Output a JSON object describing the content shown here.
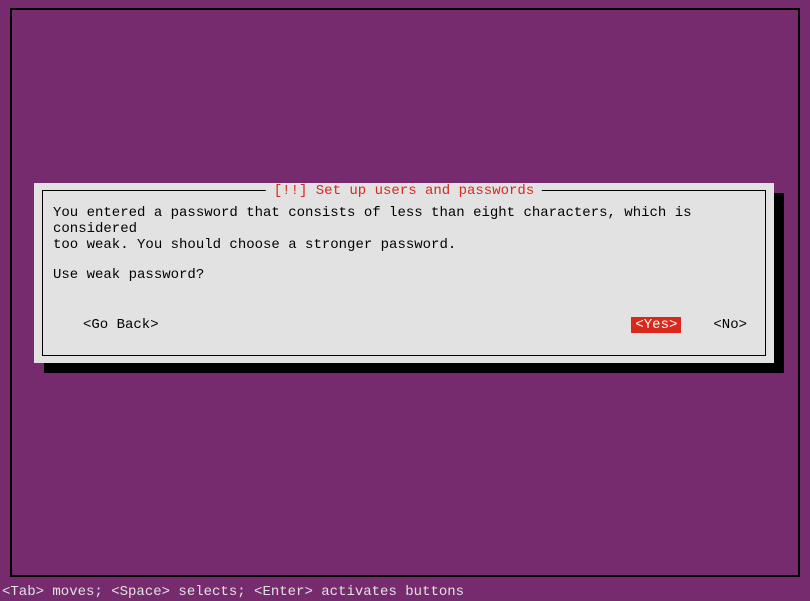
{
  "dialog": {
    "title": "[!!] Set up users and passwords",
    "message": "You entered a password that consists of less than eight characters, which is considered\ntoo weak. You should choose a stronger password.",
    "prompt": "Use weak password?",
    "buttons": {
      "goback": "<Go Back>",
      "yes": "<Yes>",
      "no": "<No>"
    }
  },
  "statusbar": {
    "text": "<Tab> moves; <Space> selects; <Enter> activates buttons"
  }
}
